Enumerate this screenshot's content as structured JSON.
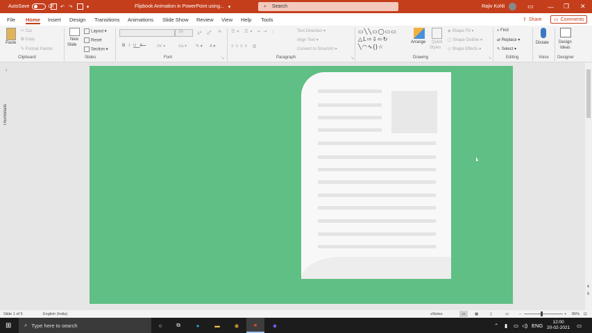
{
  "titlebar": {
    "autosave_label": "AutoSave",
    "autosave_state": "Off",
    "document_title": "Flipbook Animation in PowerPoint using...",
    "search_placeholder": "Search",
    "user_name": "Rajiv Kohli"
  },
  "tabs": [
    "File",
    "Home",
    "Insert",
    "Design",
    "Transitions",
    "Animations",
    "Slide Show",
    "Review",
    "View",
    "Help",
    "Tools"
  ],
  "active_tab": "Home",
  "share_label": "Share",
  "comments_label": "Comments",
  "ribbon": {
    "clipboard": {
      "group": "Clipboard",
      "paste": "Paste",
      "cut": "Cut",
      "copy": "Copy",
      "format_painter": "Format Painter"
    },
    "slides": {
      "group": "Slides",
      "new_slide_1": "New",
      "new_slide_2": "Slide",
      "layout": "Layout",
      "reset": "Reset",
      "section": "Section"
    },
    "font": {
      "group": "Font",
      "size": "16"
    },
    "paragraph": {
      "group": "Paragraph",
      "text_direction": "Text Direction",
      "align_text": "Align Text",
      "convert_smartart": "Convert to SmartArt"
    },
    "drawing": {
      "group": "Drawing",
      "arrange": "Arrange",
      "quick_styles_1": "Quick",
      "quick_styles_2": "Styles",
      "shape_fill": "Shape Fill",
      "shape_outline": "Shape Outline",
      "shape_effects": "Shape Effects"
    },
    "editing": {
      "group": "Editing",
      "find": "Find",
      "replace": "Replace",
      "select": "Select"
    },
    "voice": {
      "group": "Voice",
      "dictate": "Dictate"
    },
    "designer": {
      "group": "Designer",
      "design_ideas_1": "Design",
      "design_ideas_2": "Ideas"
    }
  },
  "thumbnails_label": "Thumbnails",
  "status": {
    "slide_info": "Slide 1 of 5",
    "language": "English (India)",
    "notes": "Notes",
    "zoom": "86%"
  },
  "taskbar": {
    "search_placeholder": "Type here to search",
    "language": "ENG",
    "time": "12:00",
    "date": "20-02-2021"
  },
  "colors": {
    "accent": "#c43e1c",
    "slide_bg": "#5fbf85",
    "paper": "#f8f8f8"
  }
}
